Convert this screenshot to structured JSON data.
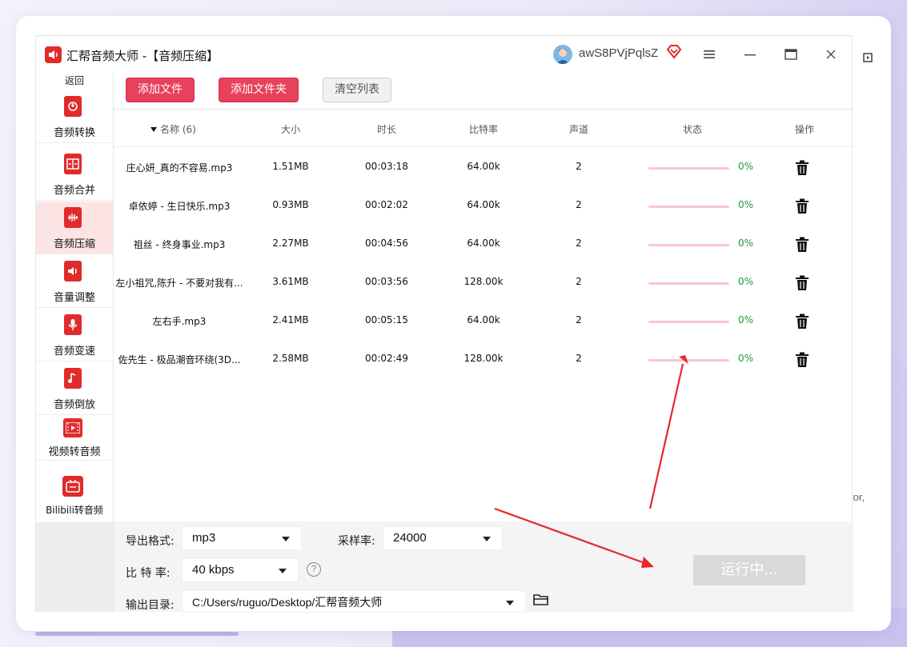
{
  "app": {
    "title": "汇帮音频大师  -【音频压缩】",
    "username": "awS8PVjPqlsZ",
    "icons": {
      "logo": "speaker-icon",
      "vip": "diamond-icon",
      "menu": "hamburger-icon",
      "minimize": "minimize-icon",
      "maximize": "maximize-icon",
      "close": "close-icon"
    }
  },
  "sidebar": {
    "back": "返回",
    "items": [
      {
        "label": "音频转换",
        "icon": "audio-convert-icon",
        "active": false
      },
      {
        "label": "音频合并",
        "icon": "audio-merge-icon",
        "active": false
      },
      {
        "label": "音频压缩",
        "icon": "audio-compress-icon",
        "active": true
      },
      {
        "label": "音量调整",
        "icon": "volume-icon",
        "active": false
      },
      {
        "label": "音频变速",
        "icon": "microphone-icon",
        "active": false
      },
      {
        "label": "音频倒放",
        "icon": "music-note-icon",
        "active": false
      },
      {
        "label": "视频转音频",
        "icon": "film-icon",
        "active": false
      },
      {
        "label": "Bilibili转音频",
        "icon": "tv-icon",
        "active": false
      }
    ]
  },
  "toolbar": {
    "add_file": "添加文件",
    "add_folder": "添加文件夹",
    "clear_list": "清空列表"
  },
  "table": {
    "headers": {
      "name": "名称",
      "count": "(6)",
      "size": "大小",
      "duration": "时长",
      "bitrate": "比特率",
      "channels": "声道",
      "status": "状态",
      "action": "操作"
    },
    "rows": [
      {
        "name": "庄心妍_真的不容易.mp3",
        "size": "1.51MB",
        "duration": "00:03:18",
        "bitrate": "64.00k",
        "channels": "2",
        "progress": 0,
        "percent": "0%"
      },
      {
        "name": "卓依婷 - 生日快乐.mp3",
        "size": "0.93MB",
        "duration": "00:02:02",
        "bitrate": "64.00k",
        "channels": "2",
        "progress": 0,
        "percent": "0%"
      },
      {
        "name": "祖丝 - 终身事业.mp3",
        "size": "2.27MB",
        "duration": "00:04:56",
        "bitrate": "64.00k",
        "channels": "2",
        "progress": 0,
        "percent": "0%"
      },
      {
        "name": "左小祖咒,陈升 - 不要对我有...",
        "size": "3.61MB",
        "duration": "00:03:56",
        "bitrate": "128.00k",
        "channels": "2",
        "progress": 0,
        "percent": "0%"
      },
      {
        "name": "左右手.mp3",
        "size": "2.41MB",
        "duration": "00:05:15",
        "bitrate": "64.00k",
        "channels": "2",
        "progress": 0,
        "percent": "0%"
      },
      {
        "name": "佐先生 - 极品潮音环绕(3D...",
        "size": "2.58MB",
        "duration": "00:02:49",
        "bitrate": "128.00k",
        "channels": "2",
        "progress": 0,
        "percent": "0%"
      }
    ]
  },
  "settings": {
    "format_label": "导出格式:",
    "format_value": "mp3",
    "samplerate_label": "采样率:",
    "samplerate_value": "24000",
    "bitrate_label": "比 特 率:",
    "bitrate_value": "40 kbps",
    "help": "?",
    "output_label": "输出目录:",
    "output_value": "C:/Users/ruguo/Desktop/汇帮音频大师",
    "run_button": "运行中..."
  },
  "background": {
    "cut_text": "tor, "
  },
  "colors": {
    "accent": "#e8415b",
    "brand_red": "#e02b2b",
    "progress_track": "#f7c7d2",
    "percent_green": "#1a9b35",
    "active_nav": "#fde4e4",
    "annotation_arrow": "#e8282b"
  }
}
